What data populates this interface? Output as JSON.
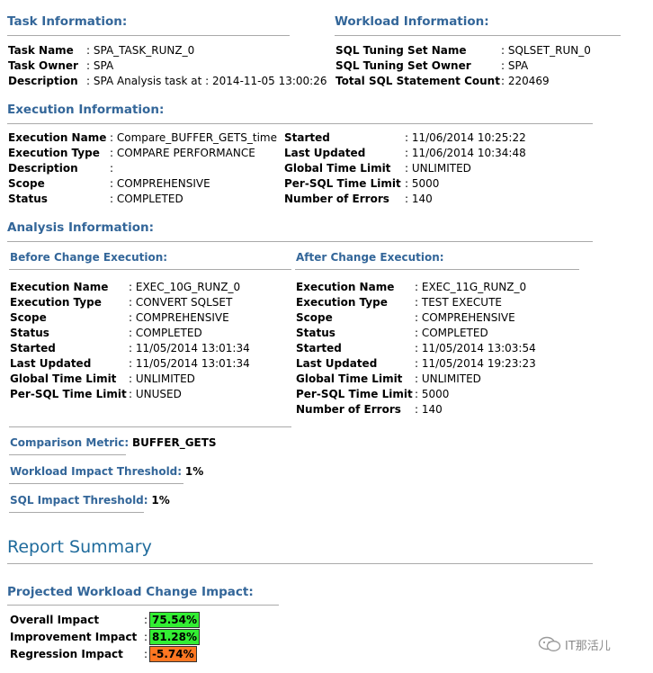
{
  "task": {
    "title": "Task Information:",
    "rows": [
      {
        "label": "Task Name",
        "value": ": SPA_TASK_RUNZ_0"
      },
      {
        "label": "Task Owner",
        "value": ": SPA"
      },
      {
        "label": "Description",
        "value": ": SPA Analysis task at : 2014-11-05 13:00:26"
      }
    ]
  },
  "workload": {
    "title": "Workload Information:",
    "rows": [
      {
        "label": "SQL Tuning Set Name",
        "value": ": SQLSET_RUN_0"
      },
      {
        "label": "SQL Tuning Set Owner",
        "value": ": SPA"
      },
      {
        "label": "Total SQL Statement Count",
        "value": ": 220469"
      }
    ]
  },
  "execution": {
    "title": "Execution Information:",
    "left": [
      {
        "label": "Execution Name",
        "value": ": Compare_BUFFER_GETS_time"
      },
      {
        "label": "Execution Type",
        "value": ": COMPARE PERFORMANCE"
      },
      {
        "label": "Description",
        "value": ":"
      },
      {
        "label": "Scope",
        "value": ": COMPREHENSIVE"
      },
      {
        "label": "Status",
        "value": ": COMPLETED"
      }
    ],
    "right": [
      {
        "label": "Started",
        "value": ": 11/06/2014 10:25:22"
      },
      {
        "label": "Last Updated",
        "value": ": 11/06/2014 10:34:48"
      },
      {
        "label": "Global Time Limit",
        "value": ": UNLIMITED"
      },
      {
        "label": "Per-SQL Time Limit",
        "value": ": 5000"
      },
      {
        "label": "Number of Errors",
        "value": ": 140"
      }
    ]
  },
  "analysis": {
    "title": "Analysis Information:",
    "before": {
      "title": "Before Change Execution:",
      "rows": [
        {
          "label": "Execution Name",
          "value": ": EXEC_10G_RUNZ_0"
        },
        {
          "label": "Execution Type",
          "value": ": CONVERT SQLSET"
        },
        {
          "label": "Scope",
          "value": ": COMPREHENSIVE"
        },
        {
          "label": "Status",
          "value": ": COMPLETED"
        },
        {
          "label": "Started",
          "value": ": 11/05/2014 13:01:34"
        },
        {
          "label": "Last Updated",
          "value": ": 11/05/2014 13:01:34"
        },
        {
          "label": "Global Time Limit",
          "value": ": UNLIMITED"
        },
        {
          "label": "Per-SQL Time Limit",
          "value": ": UNUSED"
        }
      ]
    },
    "after": {
      "title": "After Change Execution:",
      "rows": [
        {
          "label": "Execution Name",
          "value": ": EXEC_11G_RUNZ_0"
        },
        {
          "label": "Execution Type",
          "value": ": TEST EXECUTE"
        },
        {
          "label": "Scope",
          "value": ": COMPREHENSIVE"
        },
        {
          "label": "Status",
          "value": ": COMPLETED"
        },
        {
          "label": "Started",
          "value": ": 11/05/2014 13:03:54"
        },
        {
          "label": "Last Updated",
          "value": ": 11/05/2014 19:23:23"
        },
        {
          "label": "Global Time Limit",
          "value": ": UNLIMITED"
        },
        {
          "label": "Per-SQL Time Limit",
          "value": ": 5000"
        },
        {
          "label": "Number of Errors",
          "value": ": 140"
        }
      ]
    },
    "comparison_metric": {
      "label": "Comparison Metric:",
      "value": "BUFFER_GETS"
    },
    "workload_threshold": {
      "label": "Workload Impact Threshold:",
      "value": "1%"
    },
    "sql_threshold": {
      "label": "SQL Impact Threshold:",
      "value": "1%"
    }
  },
  "report": {
    "title": "Report Summary",
    "projected_title": "Projected Workload Change Impact:",
    "impacts": [
      {
        "label": "Overall Impact",
        "colon": ":",
        "value": "75.54%",
        "color": "#33ee33"
      },
      {
        "label": "Improvement Impact",
        "colon": ":",
        "value": "81.28%",
        "color": "#33ee33"
      },
      {
        "label": "Regression Impact",
        "colon": ":",
        "value": "-5.74%",
        "color": "#ff7722"
      }
    ]
  },
  "watermark": {
    "text": "IT那活儿",
    "icon": "wechat-icon"
  }
}
